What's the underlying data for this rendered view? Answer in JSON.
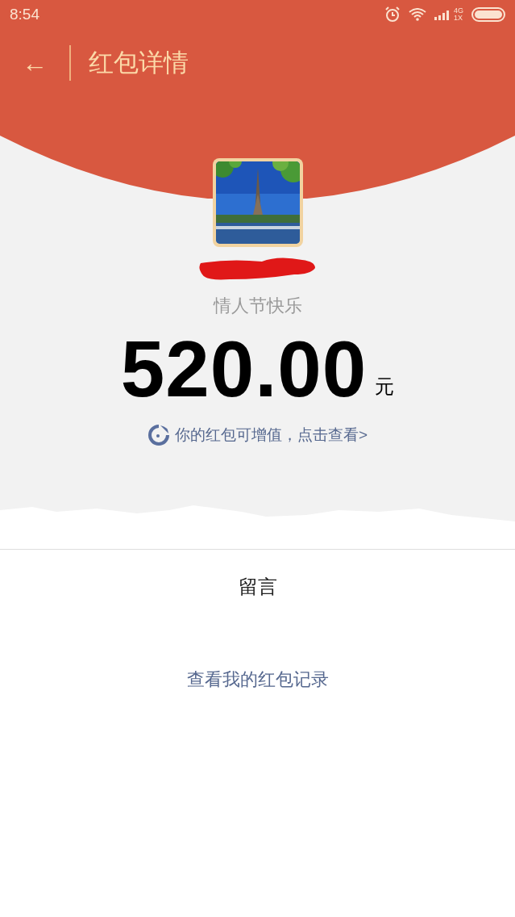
{
  "status_bar": {
    "time": "8:54",
    "network_top": "4G",
    "network_bottom": "1X"
  },
  "app_bar": {
    "back_icon": "←",
    "title": "红包详情"
  },
  "sender": {
    "greeting": "情人节快乐"
  },
  "amount": {
    "value": "520.00",
    "unit": "元"
  },
  "promo_link": "你的红包可增值，点击查看>",
  "message_section": {
    "title": "留言"
  },
  "records_link": "查看我的红包记录"
}
